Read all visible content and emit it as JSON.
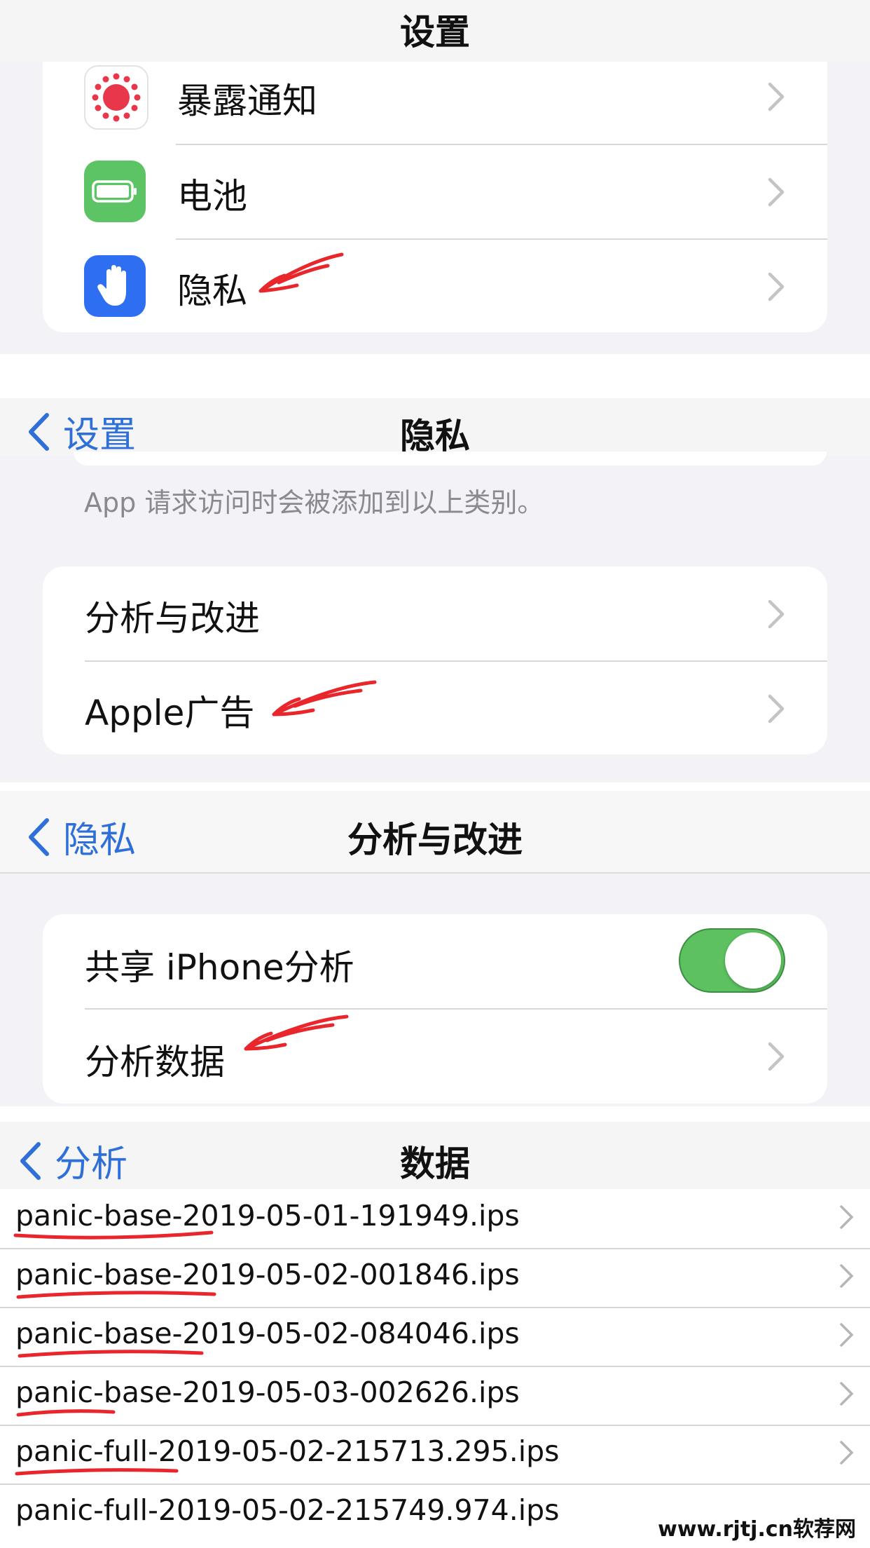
{
  "settings_panel": {
    "title": "设置",
    "items": [
      {
        "label": "暴露通知",
        "icon": "exposure-notification-icon"
      },
      {
        "label": "电池",
        "icon": "battery-icon"
      },
      {
        "label": "隐私",
        "icon": "hand-privacy-icon"
      }
    ]
  },
  "privacy_panel": {
    "back_label": "设置",
    "title": "隐私",
    "footnote": "App 请求访问时会被添加到以上类别。",
    "items": [
      {
        "label": "分析与改进"
      },
      {
        "label": "Apple广告"
      }
    ]
  },
  "analytics_panel": {
    "back_label": "隐私",
    "title": "分析与改进",
    "share_label": "共享 iPhone分析",
    "share_enabled": true,
    "data_label": "分析数据"
  },
  "data_panel": {
    "back_label": "分析",
    "title": "数据",
    "files": [
      "panic-base-2019-05-01-191949.ips",
      "panic-base-2019-05-02-001846.ips",
      "panic-base-2019-05-02-084046.ips",
      "panic-base-2019-05-03-002626.ips",
      "panic-full-2019-05-02-215713.295.ips",
      "panic-full-2019-05-02-215749.974.ips"
    ]
  },
  "watermark": "www.rjtj.cn软荐网",
  "colors": {
    "accent_blue": "#2f6fd8",
    "toggle_green": "#5cc15e",
    "annotation_red": "#e8262c",
    "battery_green": "#5dc466",
    "privacy_blue": "#2d6ff0"
  }
}
